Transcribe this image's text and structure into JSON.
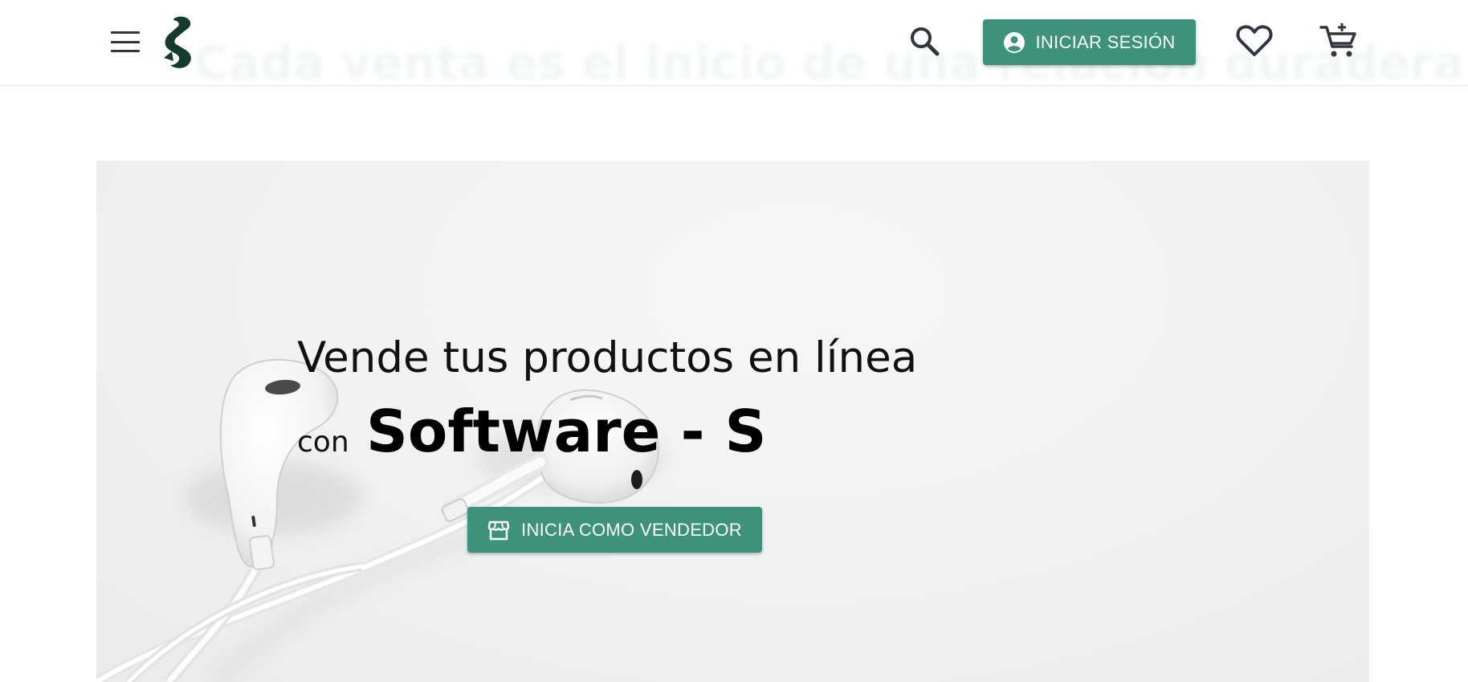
{
  "header": {
    "ghost_tagline": "Cada venta es el inicio de una relación duradera",
    "menu_icon": "menu-icon",
    "logo_icon": "software-s-logo",
    "search_icon": "search-icon",
    "login_label": "INICIAR SESIÓN",
    "login_icon": "account-circle-icon",
    "favorites_icon": "heart-outline-icon",
    "cart_icon": "cart-plus-icon",
    "accent_color": "#3e917a",
    "logo_color": "#153a30"
  },
  "hero": {
    "title": "Vende tus productos en línea",
    "connector": "con",
    "brand": "Software - S",
    "cta_label": "INICIA COMO VENDEDOR",
    "cta_icon": "storefront-icon",
    "background_image": "white-earphones-photo"
  }
}
